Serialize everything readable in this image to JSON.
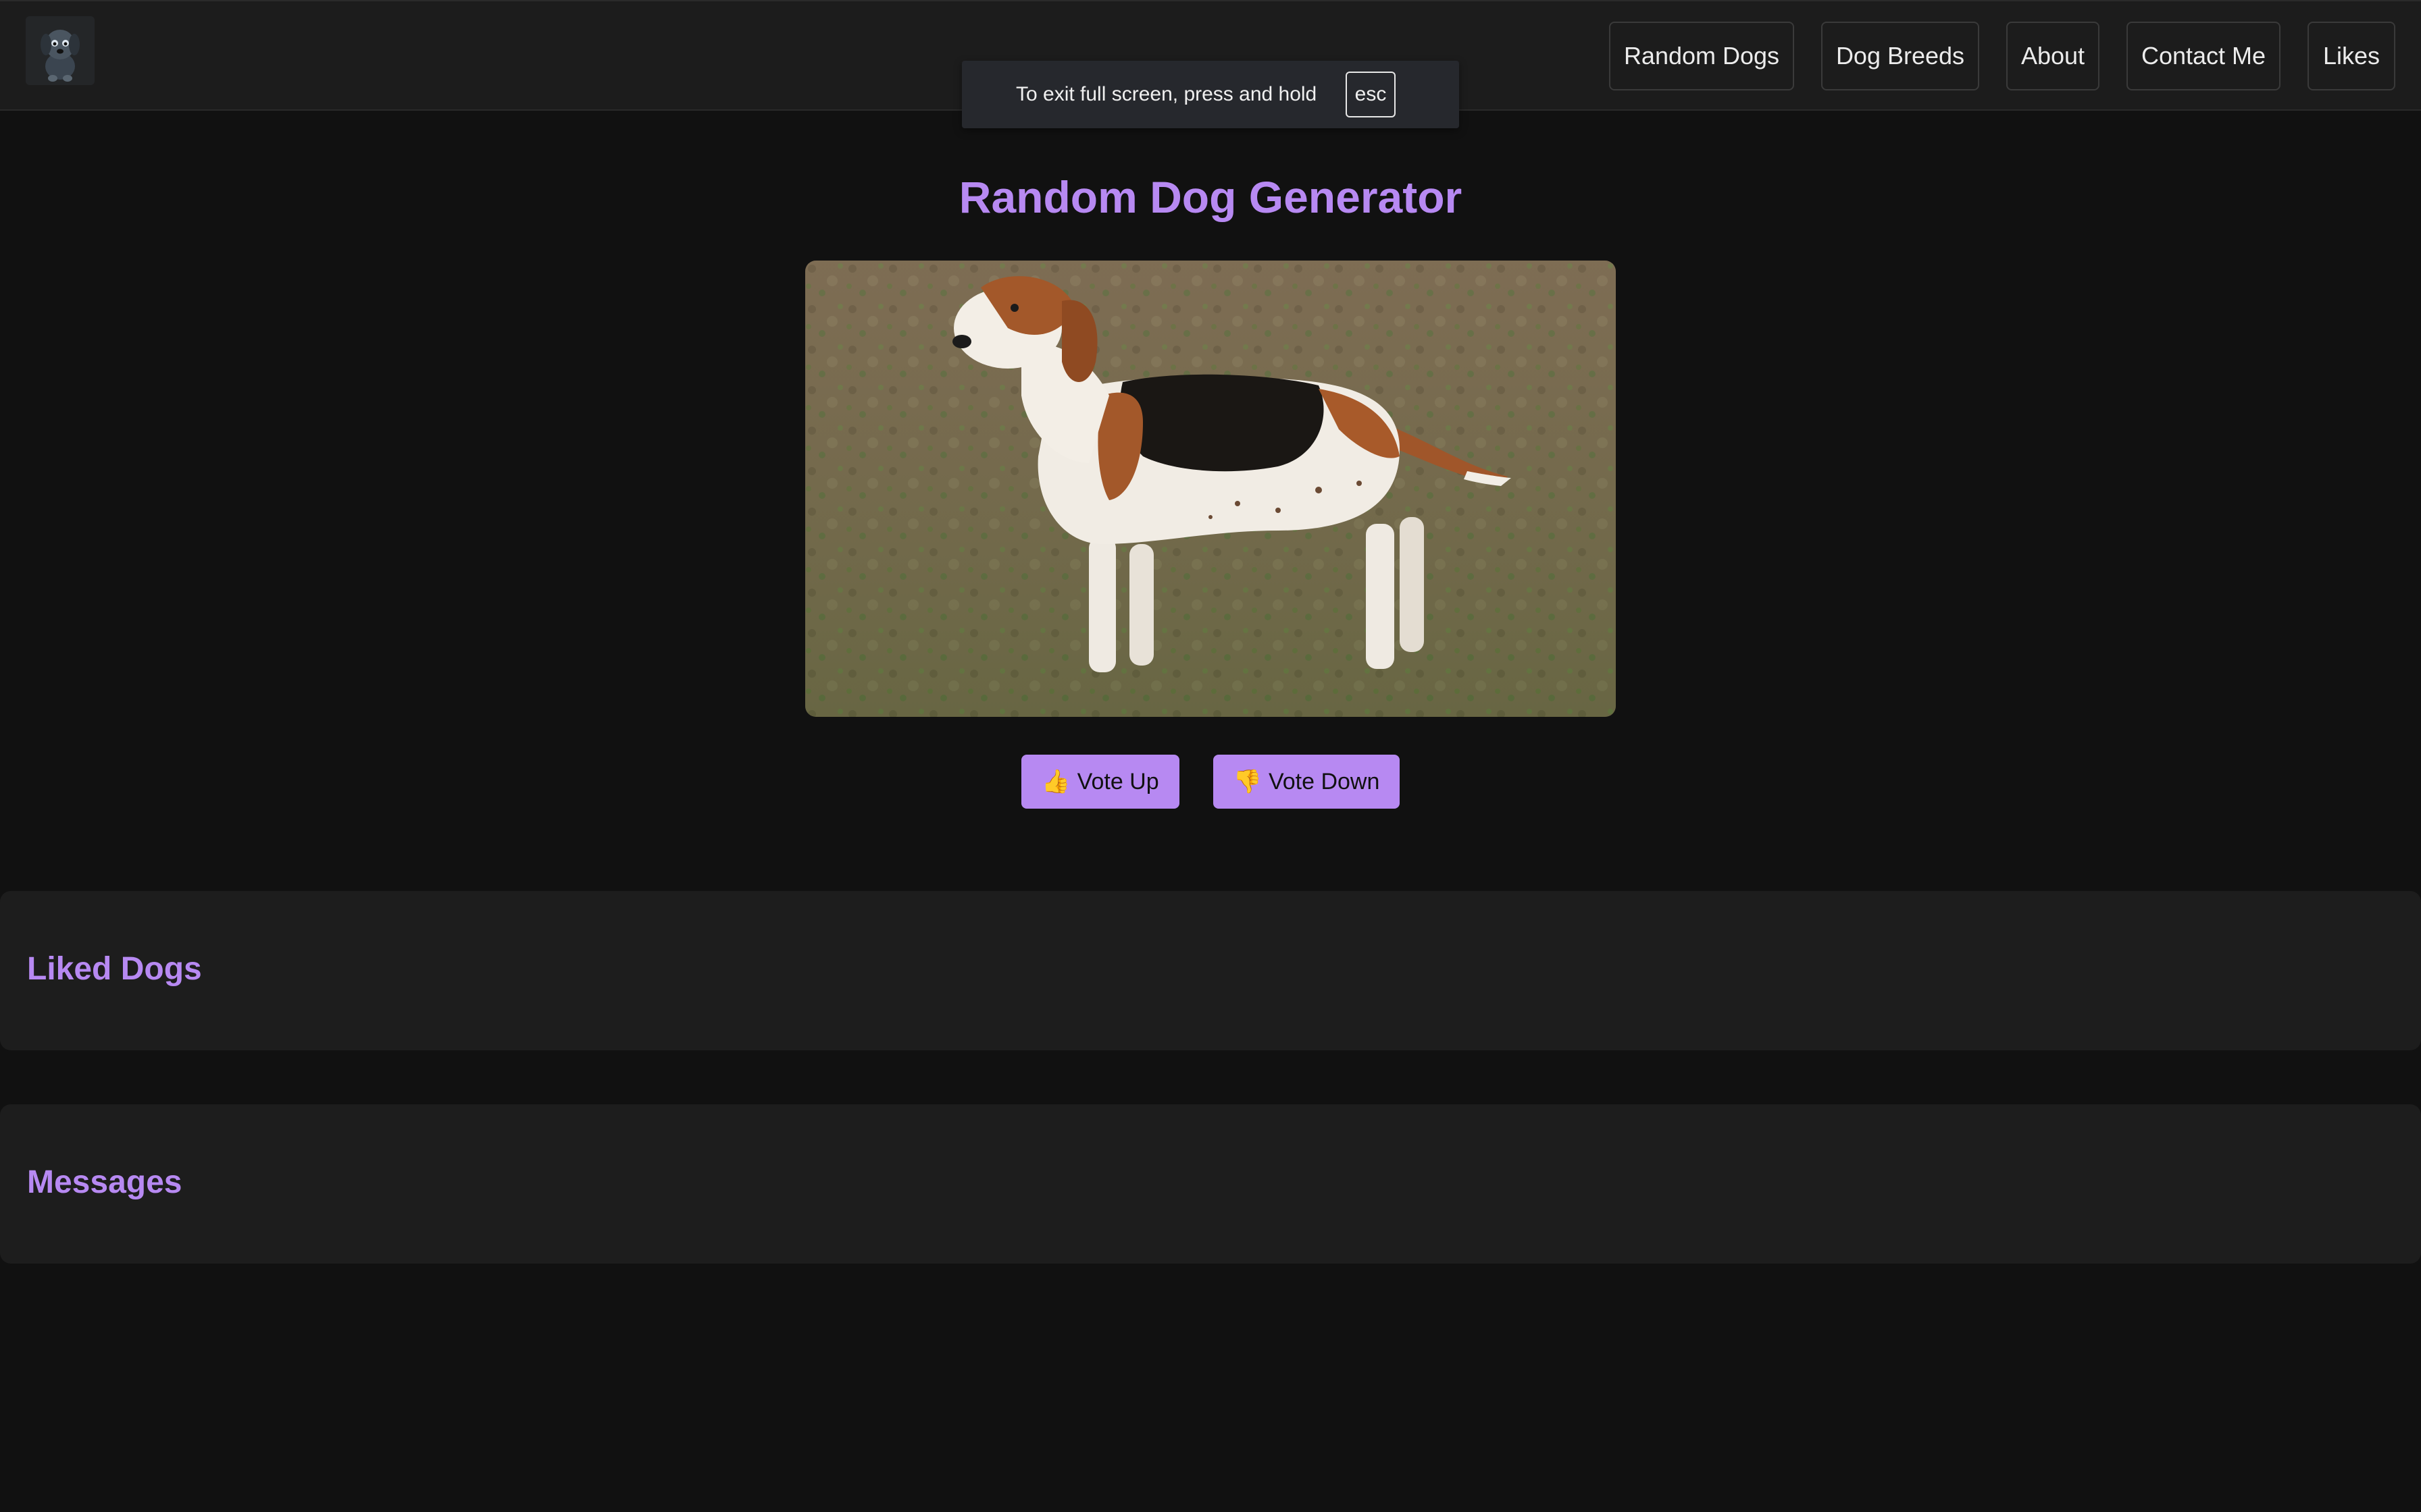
{
  "header": {
    "logo_icon": "dog-avatar-logo",
    "nav": [
      {
        "label": "Random Dogs"
      },
      {
        "label": "Dog Breeds"
      },
      {
        "label": "About"
      },
      {
        "label": "Contact Me"
      },
      {
        "label": "Likes"
      }
    ]
  },
  "fullscreen_toast": {
    "text": "To exit full screen, press and hold",
    "key": "esc"
  },
  "main": {
    "title": "Random Dog Generator",
    "image_icon": "dog-photo",
    "vote_up": {
      "icon": "👍",
      "label": "Vote Up"
    },
    "vote_down": {
      "icon": "👎",
      "label": "Vote Down"
    }
  },
  "liked_section": {
    "title": "Liked Dogs"
  },
  "messages_section": {
    "title": "Messages"
  },
  "colors": {
    "accent": "#b789f2",
    "background": "#111111",
    "panel": "#1d1d1d",
    "navbar": "#1c1c1c"
  }
}
